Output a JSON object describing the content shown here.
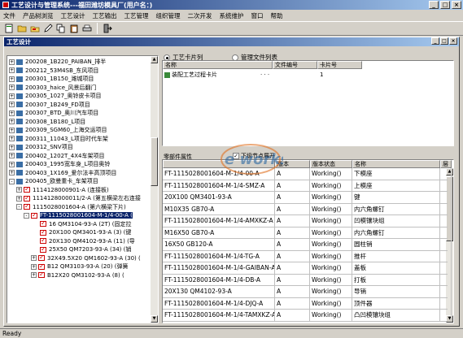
{
  "window": {
    "title": "工艺设计与管理系统---福田潍坊模具厂(用户名：)",
    "min": "_",
    "max": "□",
    "close": "×"
  },
  "menu": [
    "文件",
    "产品树浏览",
    "工艺设计",
    "工艺输出",
    "工艺管理",
    "组织管理",
    "二次开发",
    "系统维护",
    "窗口",
    "帮助"
  ],
  "toolbar": {
    "icons": [
      "new-icon",
      "open-icon",
      "folder-icon",
      "edit-icon",
      "copy-icon",
      "paste-icon",
      "print-icon",
      "exit-icon"
    ]
  },
  "mdi": {
    "title": "工艺设计",
    "min": "_",
    "max": "□",
    "close": "×"
  },
  "tree": {
    "items": [
      {
        "indent": 0,
        "exp": "+",
        "icon": "folder",
        "label": "200208_1B220_PAIBAN_排半"
      },
      {
        "indent": 0,
        "exp": "+",
        "icon": "folder",
        "label": "200212_53M4SB_东风项目"
      },
      {
        "indent": 0,
        "exp": "+",
        "icon": "folder",
        "label": "200301_1B150_潍城项目"
      },
      {
        "indent": 0,
        "exp": "+",
        "icon": "folder",
        "label": "200303_haice_风景后翻门"
      },
      {
        "indent": 0,
        "exp": "+",
        "icon": "folder",
        "label": "200305_1027_奥铃皮卡项目"
      },
      {
        "indent": 0,
        "exp": "+",
        "icon": "folder",
        "label": "200307_1B249_FD项目"
      },
      {
        "indent": 0,
        "exp": "+",
        "icon": "folder",
        "label": "200307_BTD_奥川汽车项目"
      },
      {
        "indent": 0,
        "exp": "+",
        "icon": "folder",
        "label": "200308_1B180_L项目"
      },
      {
        "indent": 0,
        "exp": "+",
        "icon": "folder",
        "label": "200309_SGM60_上海交运项目"
      },
      {
        "indent": 0,
        "exp": "+",
        "icon": "folder",
        "label": "200311_11043_L项目时代车架"
      },
      {
        "indent": 0,
        "exp": "+",
        "icon": "folder",
        "label": "200312_SNV项目"
      },
      {
        "indent": 0,
        "exp": "+",
        "icon": "folder",
        "label": "200402_1202T_4X4车架项目"
      },
      {
        "indent": 0,
        "exp": "+",
        "icon": "folder",
        "label": "200403_1995宽车身_L项目奥铃"
      },
      {
        "indent": 0,
        "exp": "+",
        "icon": "folder",
        "label": "200403_1X169_爱尔法丰高顶项目"
      },
      {
        "indent": 0,
        "exp": "-",
        "icon": "folder",
        "label": "200405_欧曼重卡_车架项目"
      },
      {
        "indent": 1,
        "exp": "+",
        "icon": "red",
        "label": "1114128000901-A (连接板)"
      },
      {
        "indent": 1,
        "exp": "+",
        "icon": "red",
        "label": "1114128000011/2-A (第五横梁左右连接"
      },
      {
        "indent": 1,
        "exp": "-",
        "icon": "red",
        "label": "1115028001604-A (第六横梁下片)"
      },
      {
        "indent": 2,
        "exp": "-",
        "icon": "red",
        "label": "FT-1115028001604-M-1/4-00-A (",
        "selected": true
      },
      {
        "indent": 3,
        "exp": "",
        "icon": "red",
        "label": "16 QM3104-93-A (2T) (固定拉"
      },
      {
        "indent": 3,
        "exp": "",
        "icon": "red",
        "label": "20X100 QM3401-93-A (3) (键"
      },
      {
        "indent": 3,
        "exp": "",
        "icon": "red",
        "label": "20X130 QM4102-93-A (11) (导"
      },
      {
        "indent": 3,
        "exp": "",
        "icon": "red",
        "label": "25X50 QM7203-93-A (34) (销"
      },
      {
        "indent": 3,
        "exp": "+",
        "icon": "red",
        "label": "32X49.5X20 QM1602-93-A (30) ("
      },
      {
        "indent": 3,
        "exp": "+",
        "icon": "red",
        "label": "B12 QM3103-93-A (20) (弹簧"
      },
      {
        "indent": 3,
        "exp": "+",
        "icon": "red",
        "label": "B12X20 QM3102-93-A (8) ("
      }
    ]
  },
  "upper": {
    "radio1": "工艺卡片列",
    "radio2": "管理文件列表",
    "headers": [
      "名称",
      "文件编号",
      "卡片号"
    ],
    "rows": [
      {
        "name": "装配工艺过程卡片",
        "file": "· · ·",
        "card": "1"
      }
    ]
  },
  "middle": {
    "label": "零部件属性",
    "check_label": "下级节点展开"
  },
  "grid": {
    "headers": [
      "",
      "版本",
      "版本状态",
      "名称",
      "层"
    ],
    "rows": [
      {
        "code": "FT-1115028001604-M-1/4-00-A",
        "ver": "A",
        "status": "Working()",
        "name": "下模座",
        "lvl": ""
      },
      {
        "code": "FT-1115028001604-M-1/4-SMZ-A",
        "ver": "A",
        "status": "Working()",
        "name": "上模座",
        "lvl": ""
      },
      {
        "code": "20X100 QM3401-93-A",
        "ver": "A",
        "status": "Working()",
        "name": "键",
        "lvl": ""
      },
      {
        "code": "M10X35 GB70-A",
        "ver": "A",
        "status": "Working()",
        "name": "内六角螺钉",
        "lvl": ""
      },
      {
        "code": "FT-1115028001604-M-1/4-AMXKZ-A",
        "ver": "A",
        "status": "Working()",
        "name": "凹模镶块组",
        "lvl": ""
      },
      {
        "code": "M16X50 GB70-A",
        "ver": "A",
        "status": "Working()",
        "name": "内六角螺钉",
        "lvl": ""
      },
      {
        "code": "16X50 GB120-A",
        "ver": "A",
        "status": "Working()",
        "name": "圆柱销",
        "lvl": ""
      },
      {
        "code": "FT-1115028001604-M-1/4-TG-A",
        "ver": "A",
        "status": "Working()",
        "name": "推杆",
        "lvl": ""
      },
      {
        "code": "FT-1115028001604-M-1/4-GAIBAN-A",
        "ver": "A",
        "status": "Working()",
        "name": "盖板",
        "lvl": ""
      },
      {
        "code": "FT-1115028001604-M-1/4-DB-A",
        "ver": "A",
        "status": "Working()",
        "name": "打板",
        "lvl": ""
      },
      {
        "code": "20X130 QM4102-93-A",
        "ver": "A",
        "status": "Working()",
        "name": "导销",
        "lvl": ""
      },
      {
        "code": "FT-1115028001604-M-1/4-DJQ-A",
        "ver": "A",
        "status": "Working()",
        "name": "顶件器",
        "lvl": ""
      },
      {
        "code": "FT-1115028001604-M-1/4-TAMXKZ-A",
        "ver": "A",
        "status": "Working()",
        "name": "凸凹模镶块组",
        "lvl": ""
      }
    ]
  },
  "watermark": {
    "text": "e works"
  },
  "status": "Ready"
}
